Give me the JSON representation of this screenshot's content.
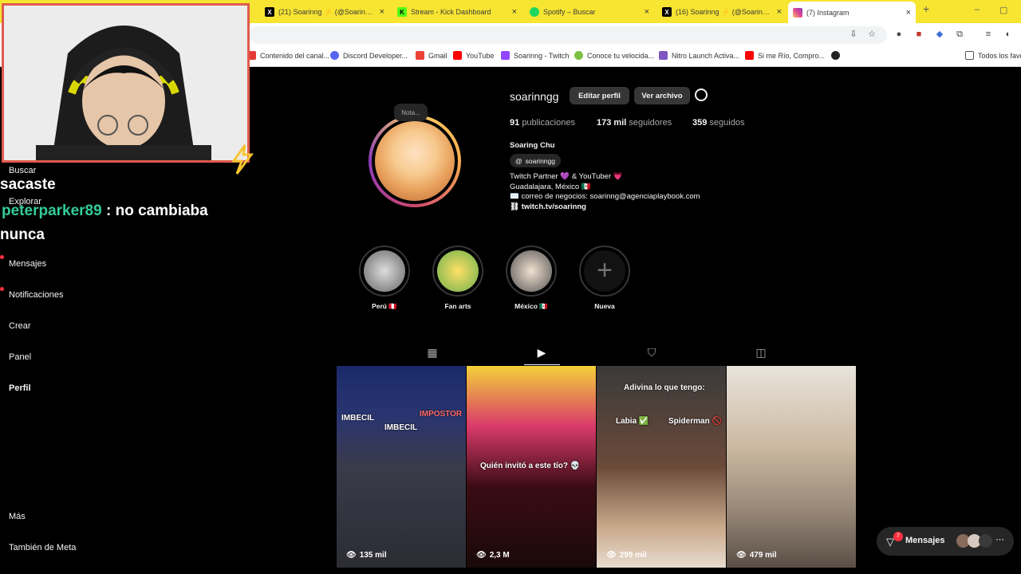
{
  "browser": {
    "tabs": [
      {
        "title": "(21) Soarinng ⚡ (@Soaringch",
        "icon": "x-logo-icon"
      },
      {
        "title": "Stream - Kick Dashboard",
        "icon": "kick-logo-icon"
      },
      {
        "title": "Spotify – Buscar",
        "icon": "spotify-logo-icon"
      },
      {
        "title": "(16) Soarinng ⚡ (@Soaringch",
        "icon": "x-logo-icon"
      },
      {
        "title": "(7) Instagram",
        "icon": "instagram-logo-icon",
        "active": true
      }
    ],
    "new_tab": "+",
    "bookmarks": [
      "Contenido del canal...",
      "Discord Developer...",
      "Gmail",
      "YouTube",
      "Soarinng - Twitch",
      "Conoce tu velocida...",
      "Nitro Launch Activa...",
      "Si me Río, Compro..."
    ],
    "all_bookmarks": "Todos los favo"
  },
  "sidebar": {
    "items": [
      "Buscar",
      "Explorar",
      "Mensajes",
      "Notificaciones",
      "Crear",
      "Panel",
      "Perfil"
    ],
    "bottom": [
      "Más",
      "También de Meta"
    ]
  },
  "chat": {
    "line1_tail": "sacaste",
    "line2_user": "peterparker89",
    "line2_text": ": no cambiaba",
    "line3": "nunca"
  },
  "profile": {
    "username": "soarinngg",
    "edit_button": "Editar perfil",
    "archive_button": "Ver archivo",
    "note": "Nota...",
    "stats": [
      {
        "value": "91",
        "label": "publicaciones"
      },
      {
        "value": "173 mil",
        "label": "seguidores"
      },
      {
        "value": "359",
        "label": "seguidos"
      }
    ],
    "name": "Soaring Chu",
    "threads": "soarinngg",
    "bio": [
      "Twitch Partner 💜 & YouTuber 💗",
      "Guadalajara, México 🇲🇽",
      "✉️ correo de negocios: soarinng@agenciaplaybook.com"
    ],
    "link": "twitch.tv/soarinng"
  },
  "highlights": [
    "Perú 🇵🇪",
    "Fan arts",
    "México 🇲🇽",
    "Nueva"
  ],
  "reels": [
    {
      "views": "135 mil",
      "overlay": [
        "IMBECIL",
        "IMBECIL",
        "IMPOSTOR"
      ]
    },
    {
      "views": "2,3 M",
      "overlay": [
        "Quién invitó a este tío? 💀"
      ]
    },
    {
      "views": "299 mil",
      "overlay": [
        "Adivina lo que tengo:",
        "Labia ✅",
        "Spiderman 🚫"
      ]
    },
    {
      "views": "479 mil",
      "overlay": []
    }
  ],
  "messages": {
    "label": "Mensajes",
    "badge": "7"
  },
  "colors": {
    "accent_badge": "#ff3040",
    "chat_user": "#33cc99",
    "webcam_border": "#e05a4e",
    "tabstrip": "#f7e531"
  }
}
